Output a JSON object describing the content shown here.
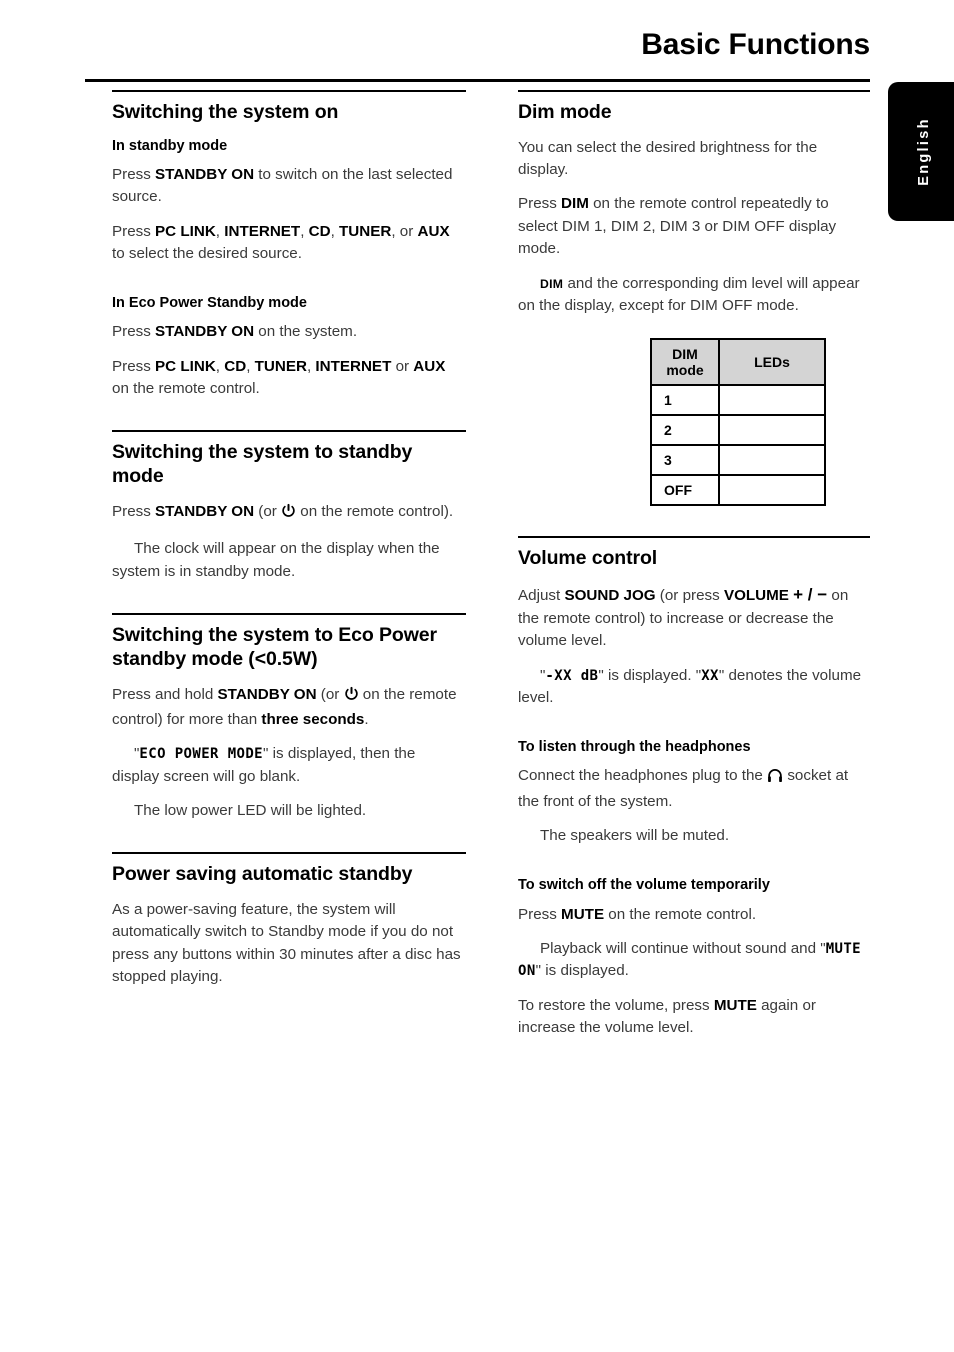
{
  "page": {
    "title": "Basic Functions",
    "language_tab": "English"
  },
  "left_column": [
    {
      "id": "switching-on",
      "title": "Switching the system on",
      "subsections": [
        {
          "heading": "In standby mode",
          "paragraphs": [
            {
              "parts": [
                {
                  "t": "Press ",
                  "s": "n"
                },
                {
                  "t": "STANDBY ON",
                  "s": "b"
                },
                {
                  "t": " to switch on the last selected source.",
                  "s": "n"
                }
              ]
            },
            {
              "parts": [
                {
                  "t": "Press ",
                  "s": "n"
                },
                {
                  "t": "PC LINK",
                  "s": "b"
                },
                {
                  "t": ", ",
                  "s": "n"
                },
                {
                  "t": "INTERNET",
                  "s": "b"
                },
                {
                  "t": ", ",
                  "s": "n"
                },
                {
                  "t": "CD",
                  "s": "b"
                },
                {
                  "t": ", ",
                  "s": "n"
                },
                {
                  "t": "TUNER",
                  "s": "b"
                },
                {
                  "t": ", or ",
                  "s": "n"
                },
                {
                  "t": "AUX",
                  "s": "b"
                },
                {
                  "t": " to select the desired source.",
                  "s": "n"
                }
              ]
            }
          ]
        },
        {
          "heading": "In Eco Power Standby mode",
          "paragraphs": [
            {
              "parts": [
                {
                  "t": "Press ",
                  "s": "n"
                },
                {
                  "t": "STANDBY ON",
                  "s": "b"
                },
                {
                  "t": " on the system.",
                  "s": "n"
                }
              ]
            },
            {
              "parts": [
                {
                  "t": "Press ",
                  "s": "n"
                },
                {
                  "t": "PC LINK",
                  "s": "b"
                },
                {
                  "t": ", ",
                  "s": "n"
                },
                {
                  "t": "CD",
                  "s": "b"
                },
                {
                  "t": ", ",
                  "s": "n"
                },
                {
                  "t": "TUNER",
                  "s": "b"
                },
                {
                  "t": ", ",
                  "s": "n"
                },
                {
                  "t": "INTERNET",
                  "s": "b"
                },
                {
                  "t": " or ",
                  "s": "n"
                },
                {
                  "t": "AUX",
                  "s": "b"
                },
                {
                  "t": " on the remote control.",
                  "s": "n"
                }
              ]
            }
          ]
        }
      ]
    },
    {
      "id": "switching-standby",
      "title": "Switching the system to standby mode",
      "subsections": [
        {
          "heading": "",
          "paragraphs": [
            {
              "parts": [
                {
                  "t": "Press ",
                  "s": "n"
                },
                {
                  "t": "STANDBY ON",
                  "s": "b"
                },
                {
                  "t": " (or ",
                  "s": "n"
                },
                {
                  "t": "",
                  "s": "icon-power"
                },
                {
                  "t": " on the remote control).",
                  "s": "n"
                }
              ]
            },
            {
              "indent": true,
              "parts": [
                {
                  "t": "The clock will appear on the display when the system is in standby mode.",
                  "s": "n"
                }
              ]
            }
          ]
        }
      ]
    },
    {
      "id": "switching-eco",
      "title": "Switching the system to Eco Power standby mode (<0.5W)",
      "subsections": [
        {
          "heading": "",
          "paragraphs": [
            {
              "parts": [
                {
                  "t": "Press and hold ",
                  "s": "n"
                },
                {
                  "t": "STANDBY ON",
                  "s": "b"
                },
                {
                  "t": " (or ",
                  "s": "n"
                },
                {
                  "t": "",
                  "s": "icon-power"
                },
                {
                  "t": " on the remote control) for more than ",
                  "s": "n"
                },
                {
                  "t": "three seconds",
                  "s": "b"
                },
                {
                  "t": ".",
                  "s": "n"
                }
              ]
            },
            {
              "indent": true,
              "parts": [
                {
                  "t": "\"",
                  "s": "n"
                },
                {
                  "t": "ECO POWER MODE",
                  "s": "lcd"
                },
                {
                  "t": "\" is displayed, then the display screen will go blank.",
                  "s": "n"
                }
              ]
            },
            {
              "indent": true,
              "parts": [
                {
                  "t": "The low power LED will be lighted.",
                  "s": "n"
                }
              ]
            }
          ]
        }
      ]
    },
    {
      "id": "power-saving",
      "title": "Power saving automatic standby",
      "subsections": [
        {
          "heading": "",
          "paragraphs": [
            {
              "parts": [
                {
                  "t": "As a power-saving feature, the system will automatically switch to Standby mode if you do not press any buttons within 30 minutes after a disc has stopped playing.",
                  "s": "n"
                }
              ]
            }
          ]
        }
      ]
    }
  ],
  "right_column": [
    {
      "id": "dim-mode",
      "title": "Dim mode",
      "subsections": [
        {
          "heading": "",
          "paragraphs": [
            {
              "parts": [
                {
                  "t": "You can select the desired brightness for the display.",
                  "s": "n"
                }
              ]
            },
            {
              "parts": [
                {
                  "t": "Press ",
                  "s": "n"
                },
                {
                  "t": "DIM",
                  "s": "b"
                },
                {
                  "t": " on the remote control repeatedly to select DIM 1, DIM 2, DIM 3 or DIM OFF display mode.",
                  "s": "n"
                }
              ]
            },
            {
              "indent": true,
              "parts": [
                {
                  "t": "DIM",
                  "s": "sc"
                },
                {
                  "t": " and the corresponding dim level will appear on the display, except for DIM OFF mode.",
                  "s": "n"
                }
              ]
            }
          ]
        }
      ],
      "table": {
        "headers": [
          "DIM mode",
          "LEDs"
        ],
        "header_line1": "DIM",
        "header_line2": "mode",
        "rows": [
          {
            "mode": "1",
            "leds": ""
          },
          {
            "mode": "2",
            "leds": ""
          },
          {
            "mode": "3",
            "leds": ""
          },
          {
            "mode": "OFF",
            "leds": ""
          }
        ]
      }
    },
    {
      "id": "volume-control",
      "title": "Volume control",
      "subsections": [
        {
          "heading": "",
          "paragraphs": [
            {
              "parts": [
                {
                  "t": "Adjust ",
                  "s": "n"
                },
                {
                  "t": "SOUND JOG",
                  "s": "b"
                },
                {
                  "t": " (or press ",
                  "s": "n"
                },
                {
                  "t": "VOLUME",
                  "s": "b"
                },
                {
                  "t": " ",
                  "s": "n"
                },
                {
                  "t": "+ / −",
                  "s": "pm"
                },
                {
                  "t": " on the remote control) to increase or decrease the volume level.",
                  "s": "n"
                }
              ]
            },
            {
              "indent": true,
              "parts": [
                {
                  "t": "\"",
                  "s": "n"
                },
                {
                  "t": "-XX dB",
                  "s": "lcd"
                },
                {
                  "t": "\" is displayed.  \"",
                  "s": "n"
                },
                {
                  "t": "XX",
                  "s": "lcd"
                },
                {
                  "t": "\" denotes the volume level.",
                  "s": "n"
                }
              ]
            }
          ]
        },
        {
          "heading": "To listen through the headphones",
          "tight": true,
          "paragraphs": [
            {
              "parts": [
                {
                  "t": "Connect the headphones plug to the ",
                  "s": "n"
                },
                {
                  "t": "",
                  "s": "icon-headphones"
                },
                {
                  "t": " socket at the front of the system.",
                  "s": "n"
                }
              ]
            },
            {
              "indent": true,
              "parts": [
                {
                  "t": "The speakers will be muted.",
                  "s": "n"
                }
              ]
            }
          ]
        },
        {
          "heading": "To switch off the volume temporarily",
          "paragraphs": [
            {
              "parts": [
                {
                  "t": "Press ",
                  "s": "n"
                },
                {
                  "t": "MUTE",
                  "s": "b"
                },
                {
                  "t": " on the remote control.",
                  "s": "n"
                }
              ]
            },
            {
              "indent": true,
              "parts": [
                {
                  "t": "Playback will continue without sound and \"",
                  "s": "n"
                },
                {
                  "t": "MUTE ON",
                  "s": "lcd"
                },
                {
                  "t": "\" is displayed.",
                  "s": "n"
                }
              ]
            },
            {
              "parts": [
                {
                  "t": "To restore the volume, press ",
                  "s": "n"
                },
                {
                  "t": "MUTE",
                  "s": "b"
                },
                {
                  "t": " again or increase the volume level.",
                  "s": "n"
                }
              ]
            }
          ]
        }
      ]
    }
  ]
}
